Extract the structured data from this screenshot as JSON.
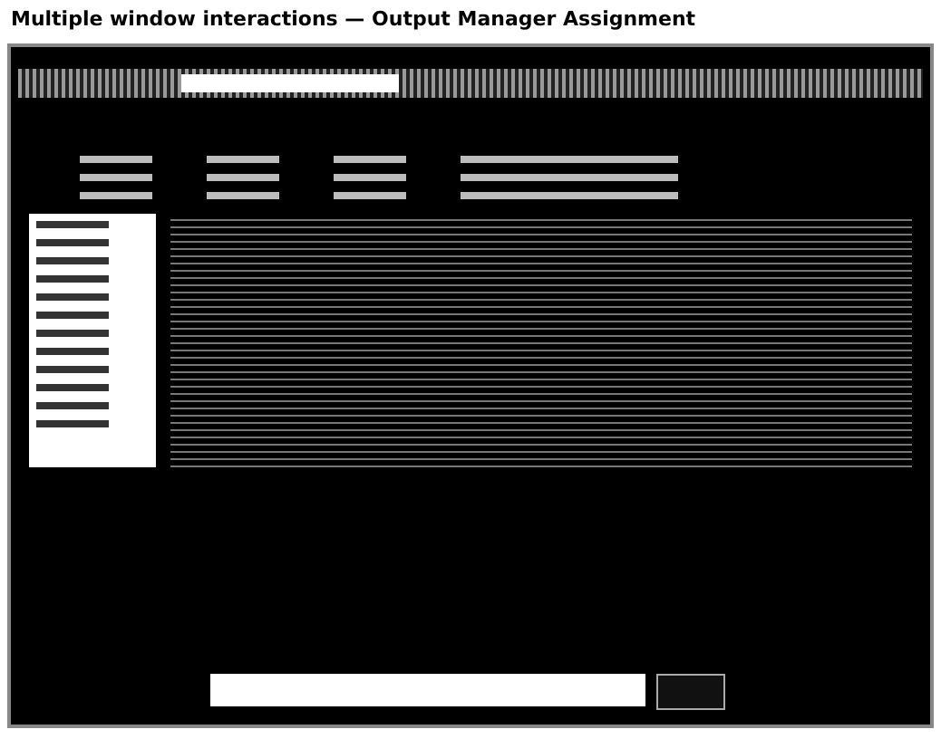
{
  "title": "Multiple window interactions — Output Manager Assignment"
}
